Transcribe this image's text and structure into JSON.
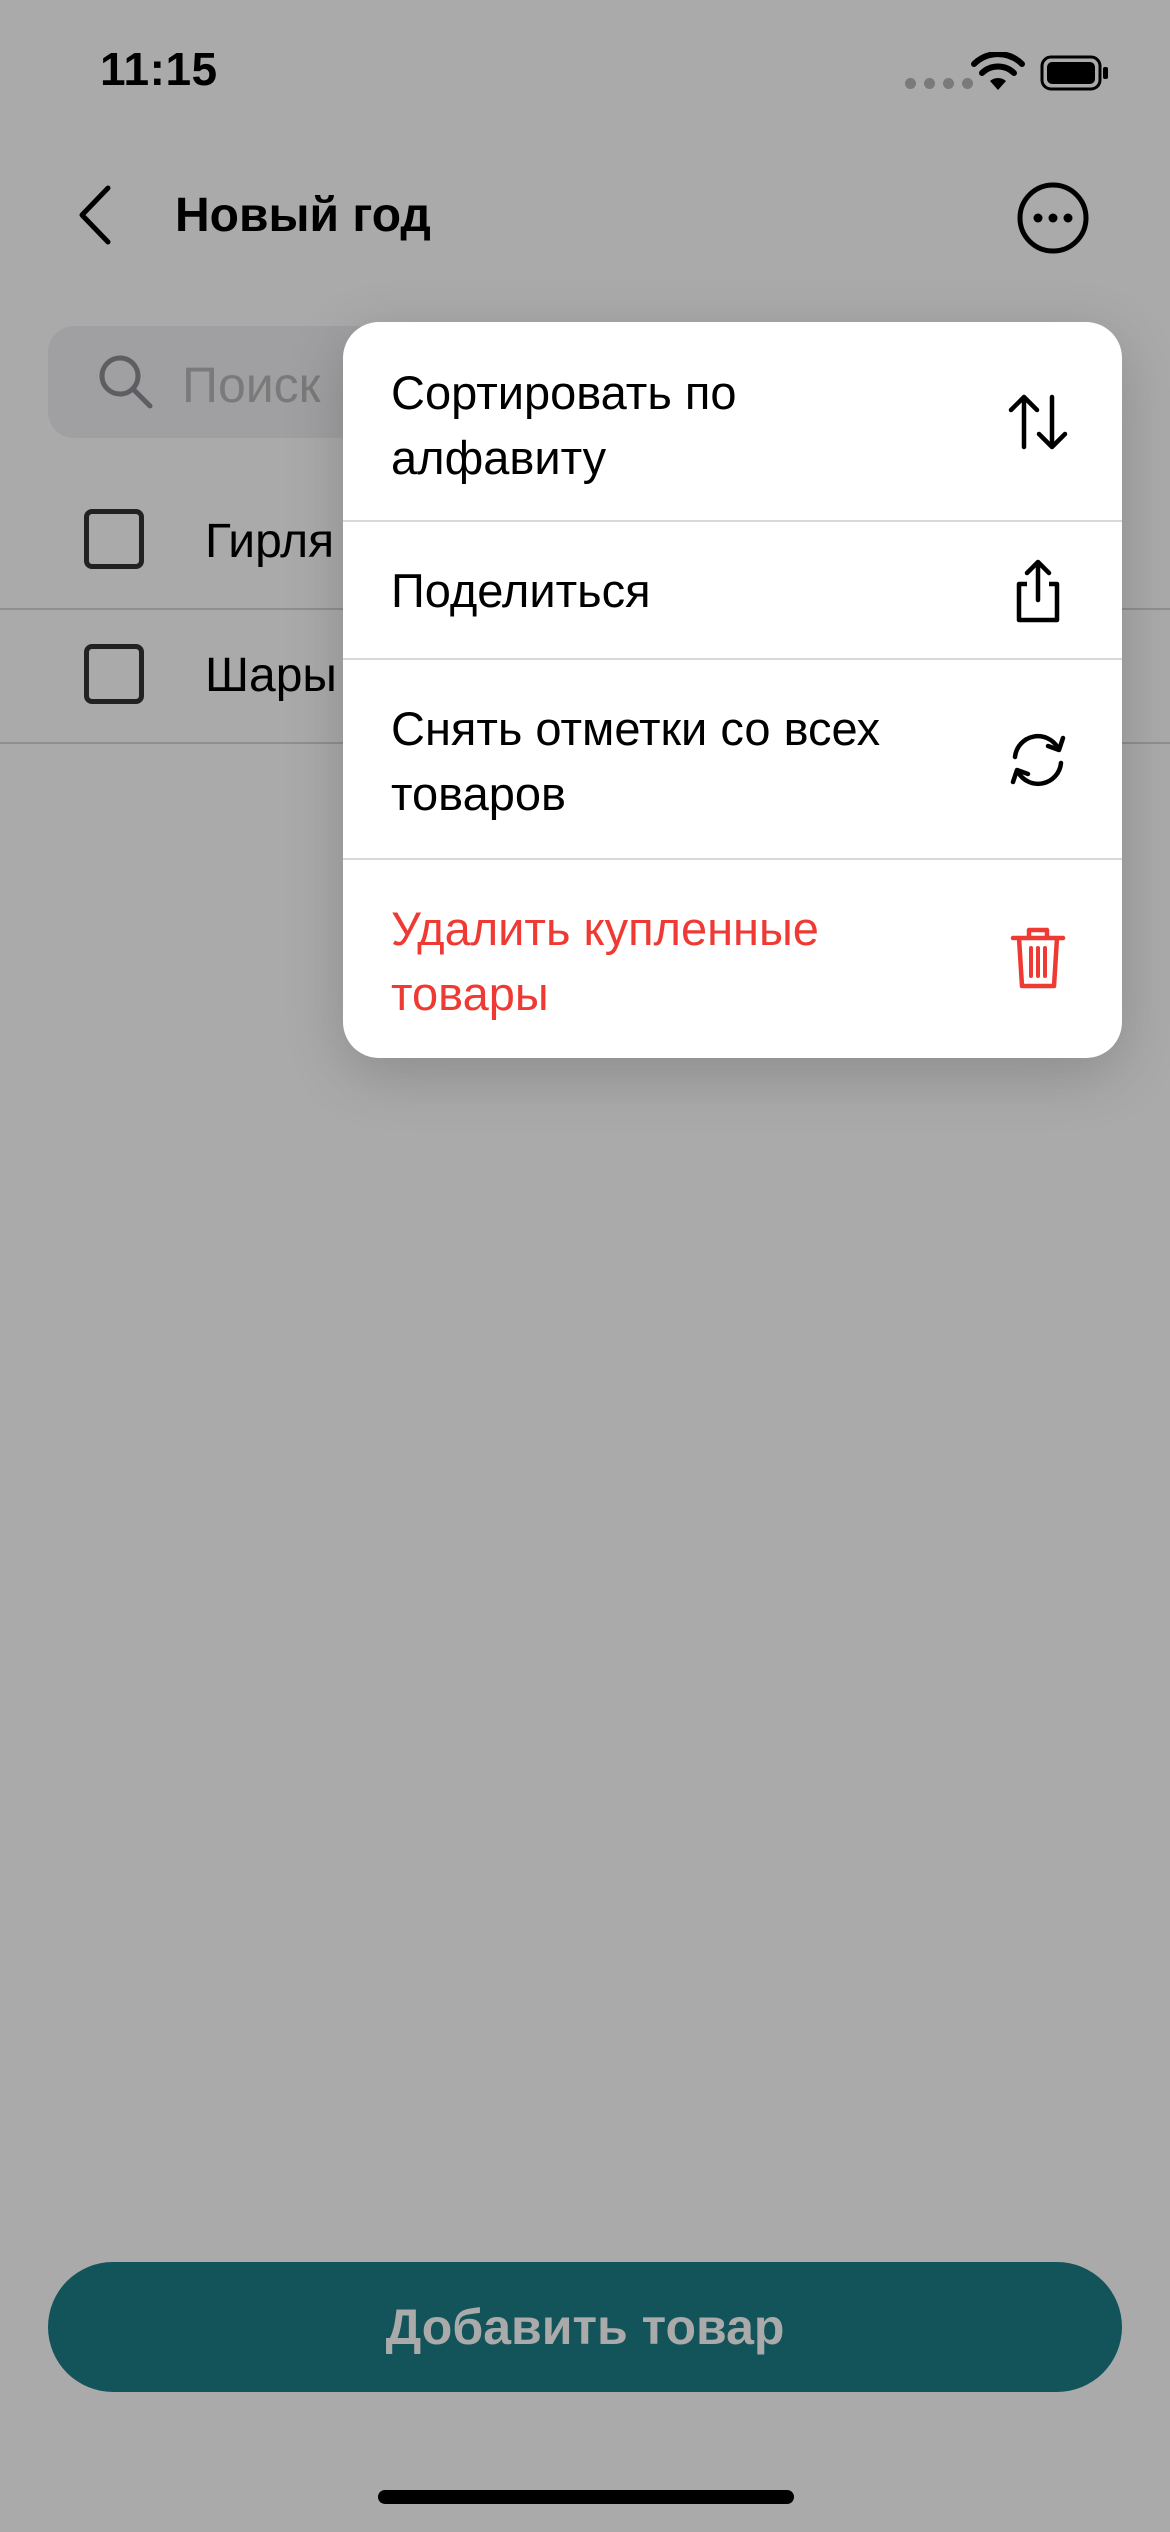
{
  "status_bar": {
    "time": "11:15"
  },
  "nav": {
    "title": "Новый год"
  },
  "search": {
    "placeholder": "Поиск"
  },
  "list": {
    "items": [
      {
        "label": "Гирля",
        "checked": false
      },
      {
        "label": "Шары",
        "checked": false
      }
    ]
  },
  "menu": {
    "items": [
      {
        "label": "Сортировать по алфавиту",
        "icon": "sort-arrows-icon"
      },
      {
        "label": "Поделиться",
        "icon": "share-icon"
      },
      {
        "label": "Снять отметки со всех товаров",
        "icon": "refresh-icon"
      },
      {
        "label": "Удалить купленные товары",
        "icon": "trash-icon",
        "destructive": true
      }
    ]
  },
  "footer": {
    "add_label": "Добавить товар"
  },
  "colors": {
    "accent": "#1c7f88",
    "destructive": "#ef3a34",
    "overlay": "rgba(0,0,0,0.335)"
  }
}
